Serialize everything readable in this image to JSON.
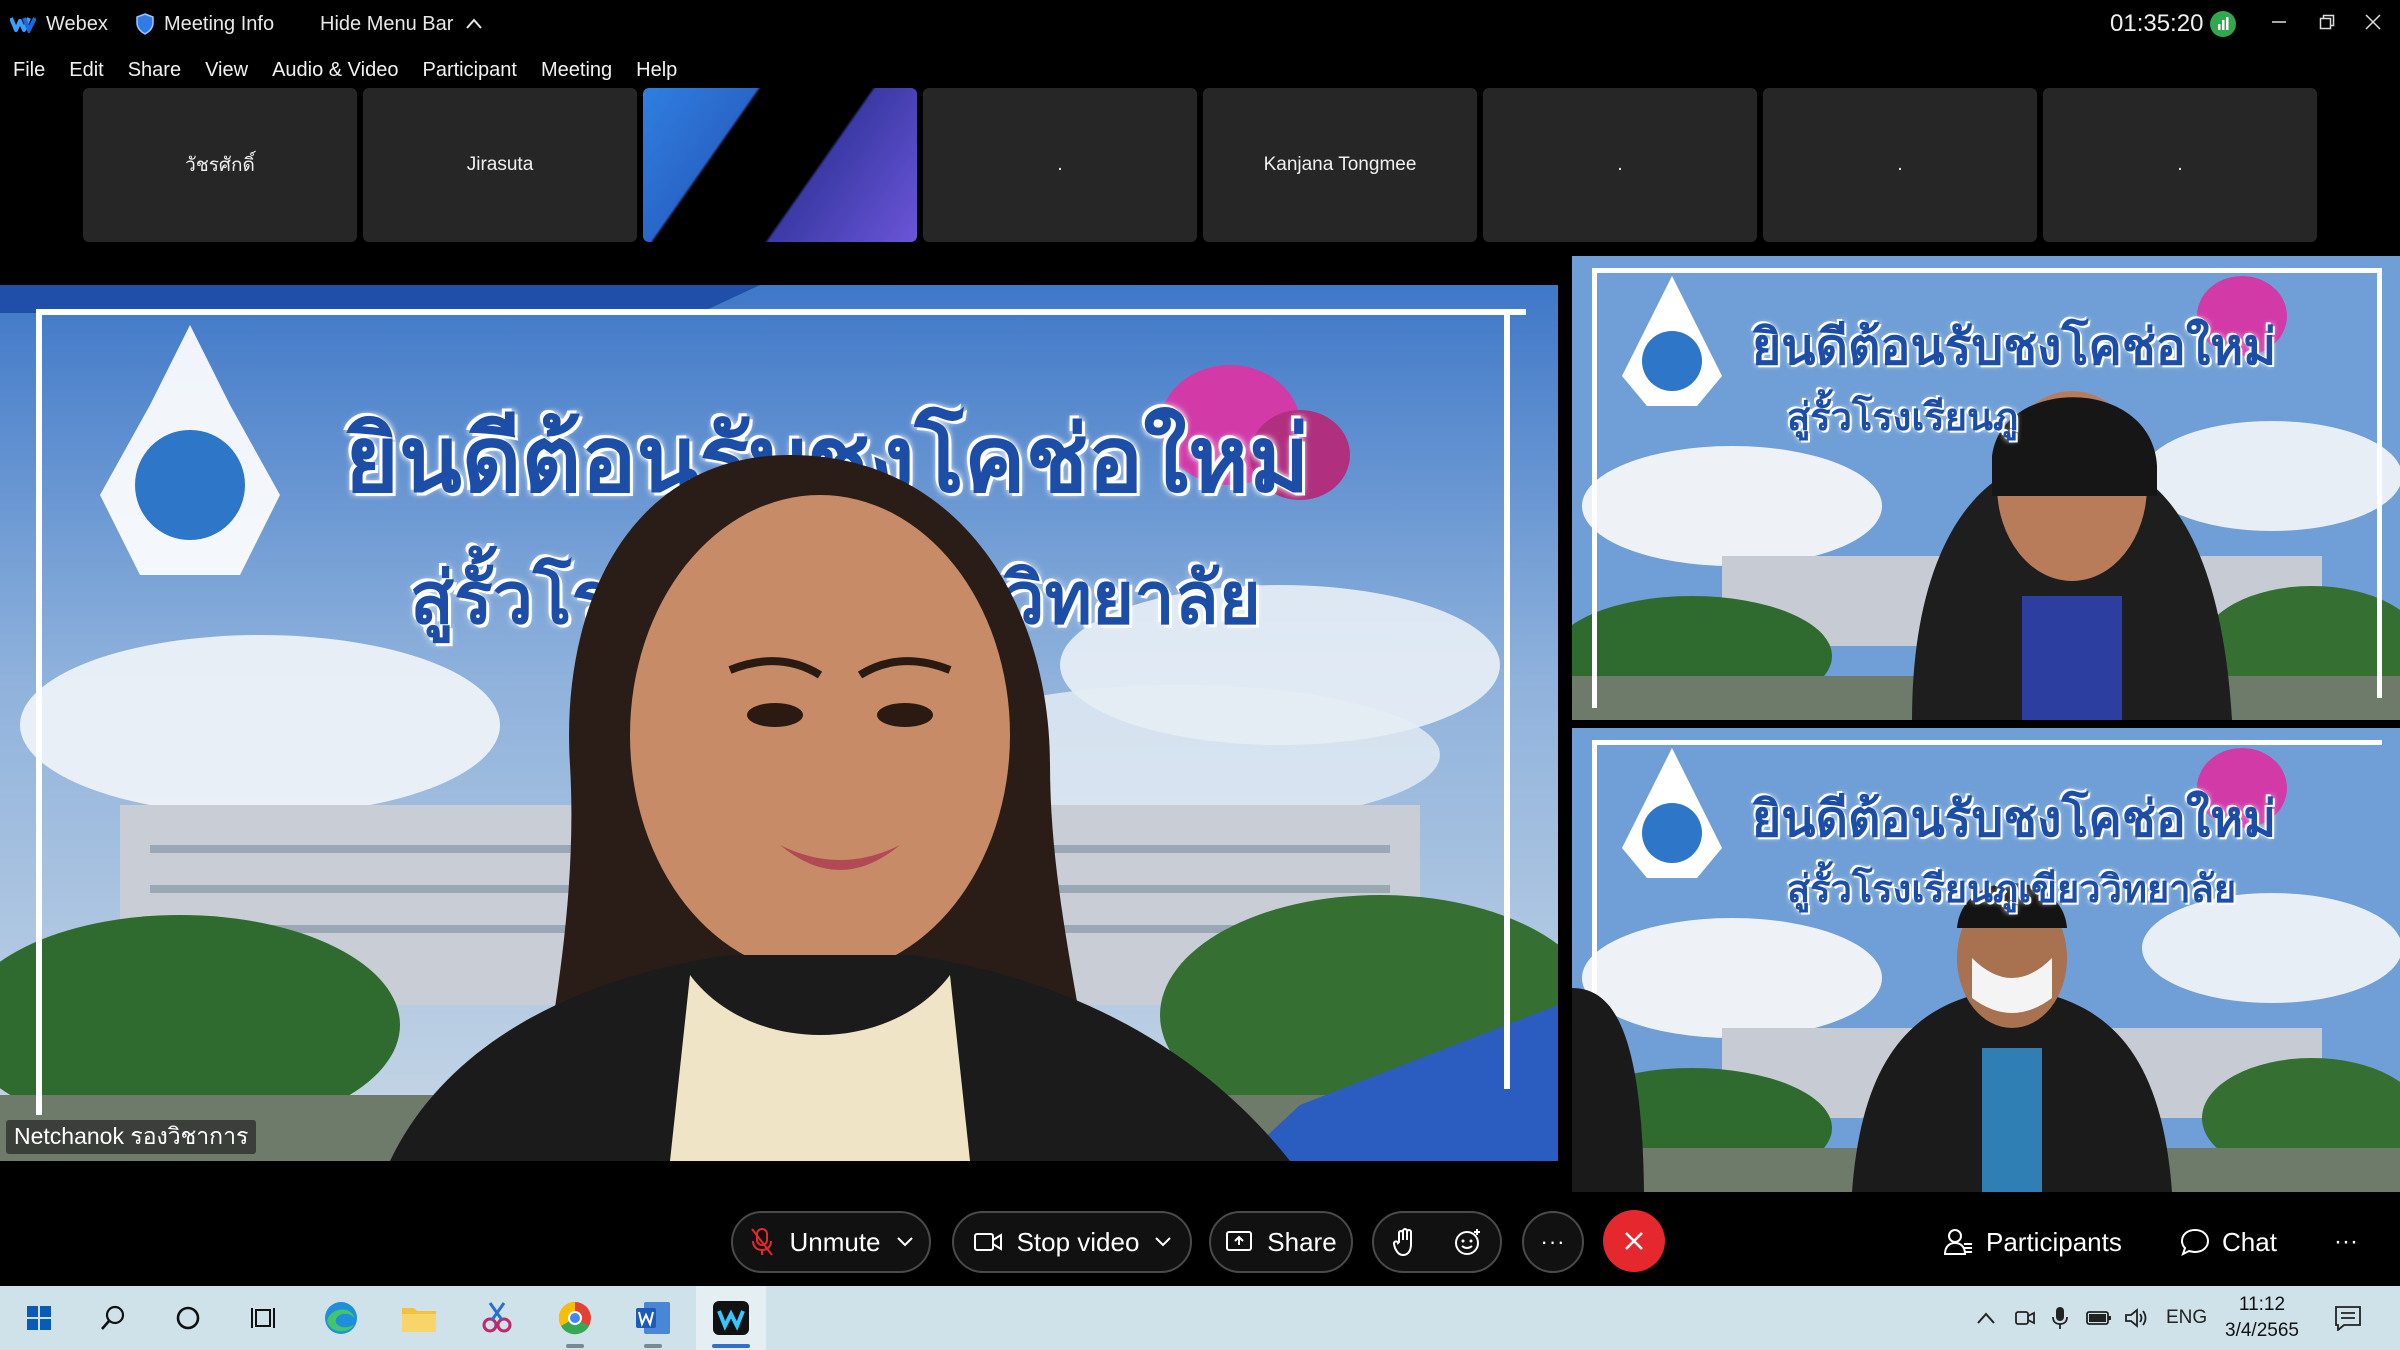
{
  "titlebar": {
    "app_name": "Webex",
    "meeting_info": "Meeting Info",
    "hide_menu_bar": "Hide Menu Bar",
    "elapsed_time": "01:35:20"
  },
  "menu": [
    "File",
    "Edit",
    "Share",
    "View",
    "Audio & Video",
    "Participant",
    "Meeting",
    "Help"
  ],
  "filmstrip": [
    {
      "name": "วัชรศักดิ์"
    },
    {
      "name": "Jirasuta"
    },
    {
      "name": ""
    },
    {
      "name": "."
    },
    {
      "name": "Kanjana Tongmee"
    },
    {
      "name": "."
    },
    {
      "name": "."
    },
    {
      "name": "."
    }
  ],
  "main_speaker": {
    "name": "Netchanok รองวิชาการ",
    "banner_line1": "ยินดีต้อนรับชงโคช่อใหม่",
    "banner_line2": "สู่รั้วโรงเรียนภูเขียววิทยาลัย"
  },
  "side_videos": [
    {
      "banner_line1": "ยินดีต้อนรับชงโคช่อใหม่",
      "banner_line2": "สู่รั้วโรงเรียนภู"
    },
    {
      "banner_line1": "ยินดีต้อนรับชงโคช่อใหม่",
      "banner_line2": "สู่รั้วโรงเรียนภูเขียววิทยาลัย"
    }
  ],
  "controls": {
    "unmute": "Unmute",
    "stop_video": "Stop video",
    "share": "Share",
    "participants": "Participants",
    "chat": "Chat",
    "more": "···"
  },
  "taskbar": {
    "language": "ENG",
    "time": "11:12",
    "date": "3/4/2565"
  },
  "colors": {
    "leave_red": "#e5282d",
    "taskbar_bg": "#cfe2ea",
    "signal_green": "#2fa84f"
  }
}
